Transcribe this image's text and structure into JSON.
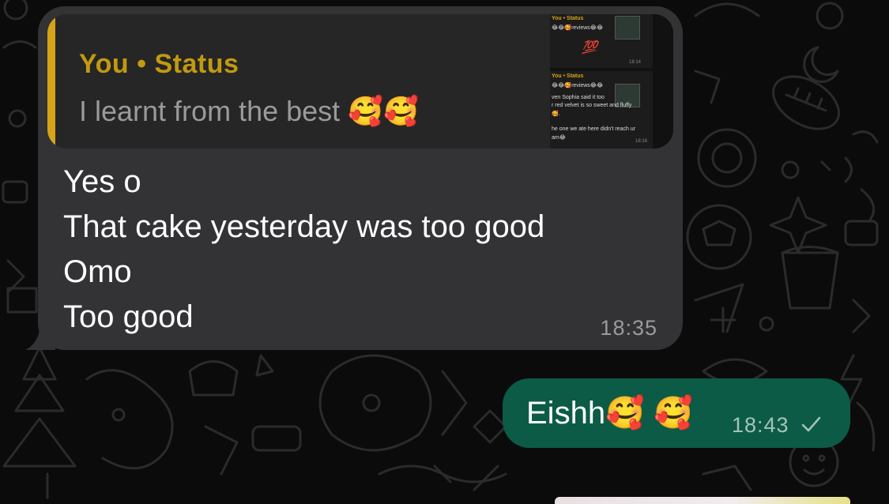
{
  "messages": {
    "incoming": {
      "quote": {
        "author": "You • Status",
        "text": "I learnt from the best 🥰🥰",
        "thumbnail": {
          "top": {
            "title": "You • Status",
            "line": "😂😂🥰reviews😂😂",
            "badge": "💯",
            "time": "18:14"
          },
          "bottom": {
            "title": "You • Status",
            "line": "😂😂🥰reviews😂😂",
            "text1": "ven Sophia said it too",
            "text2": "r red velvet is so sweet and fluffy",
            "text3": "🥰.",
            "text4": "he one we ate here didn't reach ur",
            "text5": "am😂",
            "time": "18:16"
          }
        }
      },
      "lines": [
        "Yes o",
        "That cake yesterday was too good",
        "Omo",
        "Too good"
      ],
      "time": "18:35"
    },
    "outgoing": {
      "text": "Eishh🥰 🥰",
      "time": "18:43",
      "status_icon": "single-check-icon"
    }
  },
  "colors": {
    "background": "#0b0b0b",
    "incoming_bubble": "#333335",
    "quote_background": "#262627",
    "quote_accent": "#d6a319",
    "outgoing_bubble": "#0c5b46"
  }
}
